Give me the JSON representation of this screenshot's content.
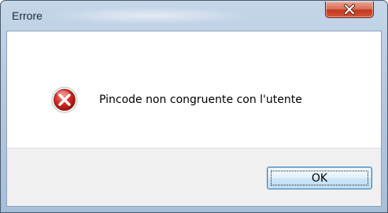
{
  "window": {
    "title": "Errore"
  },
  "titlebar": {
    "close_icon": "close-icon"
  },
  "dialog": {
    "icon": "error-icon",
    "message": "Pincode non congruente con l'utente",
    "ok_label": "OK"
  },
  "colors": {
    "close_button": "#c2391f",
    "error_icon": "#d32a22",
    "ok_button_border": "#3c7fb1"
  }
}
